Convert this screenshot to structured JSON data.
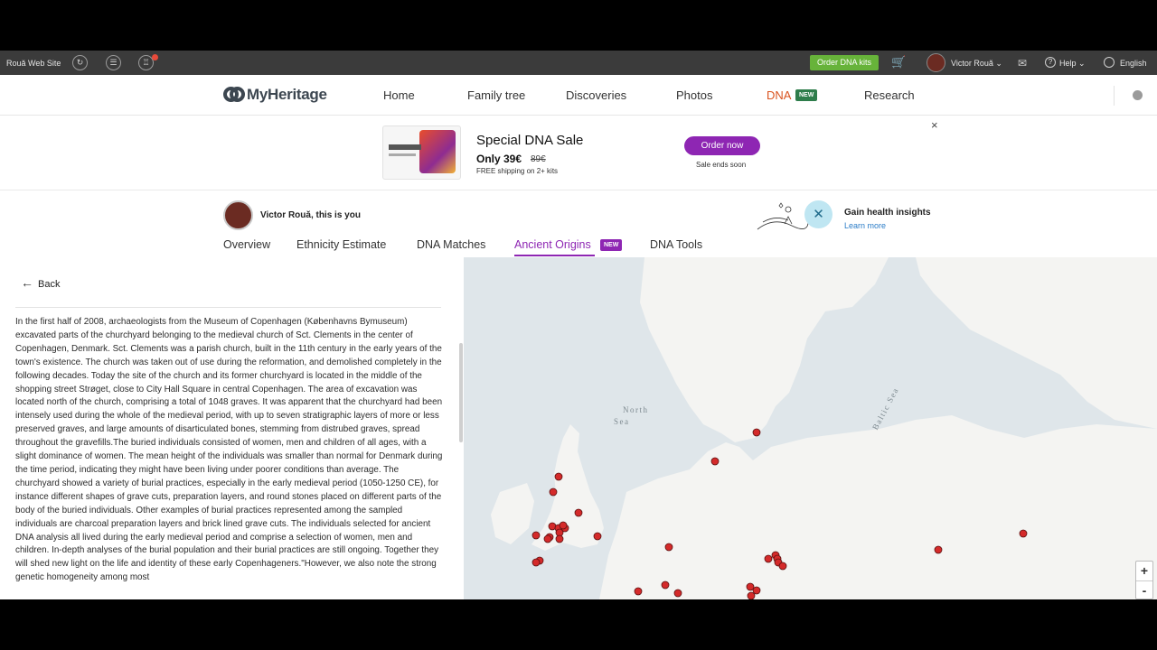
{
  "topbar": {
    "site_label": "Rouă Web Site",
    "order_kits": "Order DNA kits",
    "user_name": "Victor Rouă",
    "help": "Help",
    "language": "English"
  },
  "nav": {
    "logo": "MyHeritage",
    "items": [
      "Home",
      "Family tree",
      "Discoveries",
      "Photos",
      "DNA",
      "Research"
    ],
    "dna_badge": "NEW"
  },
  "promo": {
    "title": "Special DNA Sale",
    "price": "Only 39€",
    "old_price": "89€",
    "shipping": "FREE shipping on 2+ kits",
    "button": "Order now",
    "ends": "Sale ends soon",
    "close": "×"
  },
  "dna_header": {
    "user": "Victor Rouă, this is you",
    "tabs": [
      "Overview",
      "Ethnicity Estimate",
      "DNA Matches",
      "Ancient Origins",
      "DNA Tools"
    ],
    "tab_badge": "NEW",
    "health_title": "Gain health insights",
    "health_link": "Learn more"
  },
  "content": {
    "back": "Back",
    "text": "In the first half of 2008, archaeologists from the Museum of Copenhagen (Københavns Bymuseum) excavated parts of the churchyard belonging to the medieval church of Sct. Clements in the center of Copenhagen, Denmark. Sct. Clements was a parish church, built in the 11th century in the early years of the town's existence. The church was taken out of use during the reformation, and demolished completely in the following decades. Today the site of the church and its former churchyard is located in the middle of the shopping street Strøget, close to City Hall Square in central Copenhagen. The area of excavation was located north of the church, comprising a total of 1048 graves. It was apparent that the churchyard had been intensely used during the whole of the medieval period, with up to seven stratigraphic layers of more or less preserved graves, and large amounts of disarticulated bones, stemming from distrubed graves, spread throughout the gravefills.The buried individuals consisted of women, men and children of all ages, with a slight dominance of women. The mean height of the individuals was smaller than normal for Denmark during the time period, indicating they might have been living under poorer conditions than average. The churchyard showed a variety of burial practices, especially in the early medieval period (1050-1250 CE), for instance different shapes of grave cuts, preparation layers, and round stones placed on different parts of the body of the buried individuals. Other examples of burial practices represented among the sampled individuals are charcoal preparation layers and brick lined grave cuts. The individuals selected for ancient DNA analysis all lived during the early medieval period and comprise a selection of women, men and children. In-depth analyses of the burial population and their burial practices are still ongoing. Together they will shed new light on the life and identity of these early Copenhageners.\"However, we also note the strong genetic homogeneity among most"
  },
  "map": {
    "labels": [
      "North",
      "Sea",
      "Baltic Sea"
    ],
    "zoom_in": "+",
    "zoom_out": "-",
    "land_color": "#f4f4f2",
    "water_color": "#dfe6ea",
    "marker_color": "#d42a2a"
  },
  "colors": {
    "accent_purple": "#8e26b3",
    "dna_orange": "#d9531e",
    "kit_green": "#67b33a",
    "badge_green": "#2e7d4b",
    "badge_purple": "#8e26b3"
  }
}
